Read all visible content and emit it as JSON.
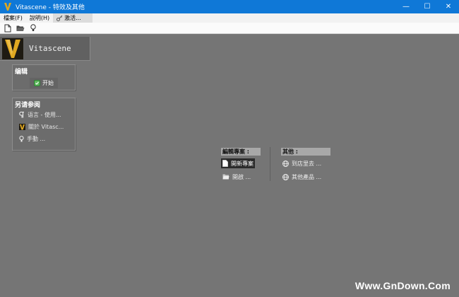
{
  "window": {
    "title": "Vitascene - 特效及其他",
    "minimize": "—",
    "maximize": "☐",
    "close": "✕"
  },
  "menu": {
    "file": "檔案(F)",
    "help": "說明(H)",
    "activate": "激活..."
  },
  "app": {
    "name": "Vitascene"
  },
  "edit_panel": {
    "title": "编辑",
    "start_label": "开始"
  },
  "see_also_panel": {
    "title": "另请参阅",
    "items": [
      {
        "label": "语言 - 使用...",
        "icon": "paragraph-icon"
      },
      {
        "label": "關於 Vitasc...",
        "icon": "vitascene-logo-icon"
      },
      {
        "label": "手動 ...",
        "icon": "lightbulb-icon"
      }
    ]
  },
  "edit_project": {
    "title": "編輯專案 :",
    "items": [
      {
        "label": "開新專案",
        "icon": "new-file-icon",
        "selected": true
      },
      {
        "label": "開啟 ...",
        "icon": "open-folder-icon",
        "selected": false
      }
    ]
  },
  "other": {
    "title": "其他 :",
    "items": [
      {
        "label": "到店里去 ...",
        "icon": "globe-icon"
      },
      {
        "label": "其他產品 ...",
        "icon": "globe-icon"
      }
    ]
  },
  "watermark": "Www.GnDown.Com",
  "colors": {
    "titlebar": "#0f78d7",
    "background": "#757575",
    "accent_logo": "#e0a821"
  }
}
